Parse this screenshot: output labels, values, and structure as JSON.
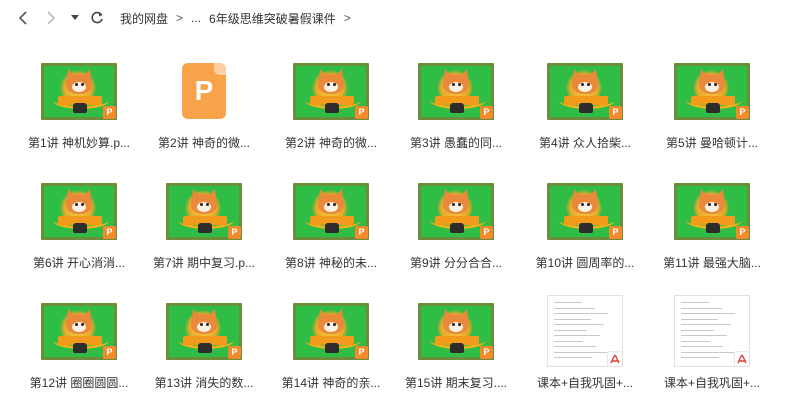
{
  "toolbar": {
    "back_icon": "chevron-left-icon",
    "forward_icon": "chevron-right-icon",
    "history_icon": "caret-down-icon",
    "refresh_icon": "refresh-icon"
  },
  "breadcrumb": {
    "root": "我的网盘",
    "separator": ">",
    "ellipsis": "...",
    "current": "6年级思维突破暑假课件"
  },
  "colors": {
    "slide_green": "#2fbd45",
    "ppt_orange": "#f38a2b",
    "pdf_red": "#e43a3a"
  },
  "files": [
    {
      "label": "第1讲 神机妙算.p...",
      "kind": "ppt-thumb"
    },
    {
      "label": "第2讲 神奇的微...",
      "kind": "ppt-icon"
    },
    {
      "label": "第2讲 神奇的微...",
      "kind": "ppt-thumb"
    },
    {
      "label": "第3讲 愚蠢的同...",
      "kind": "ppt-thumb"
    },
    {
      "label": "第4讲 众人拾柴...",
      "kind": "ppt-thumb"
    },
    {
      "label": "第5讲 曼哈顿计...",
      "kind": "ppt-thumb"
    },
    {
      "label": "第6讲 开心消消...",
      "kind": "ppt-thumb"
    },
    {
      "label": "第7讲 期中复习.p...",
      "kind": "ppt-thumb"
    },
    {
      "label": "第8讲 神秘的未...",
      "kind": "ppt-thumb"
    },
    {
      "label": "第9讲 分分合合...",
      "kind": "ppt-thumb"
    },
    {
      "label": "第10讲 圆周率的...",
      "kind": "ppt-thumb"
    },
    {
      "label": "第11讲 最强大脑...",
      "kind": "ppt-thumb"
    },
    {
      "label": "第12讲 圈圈圆圆...",
      "kind": "ppt-thumb"
    },
    {
      "label": "第13讲 消失的数...",
      "kind": "ppt-thumb"
    },
    {
      "label": "第14讲 神奇的亲...",
      "kind": "ppt-thumb"
    },
    {
      "label": "第15讲 期末复习....",
      "kind": "ppt-thumb"
    },
    {
      "label": "课本+自我巩固+...",
      "kind": "pdf-thumb"
    },
    {
      "label": "课本+自我巩固+...",
      "kind": "pdf-thumb"
    }
  ],
  "badges": {
    "ppt": "P",
    "pdf": "⅄"
  }
}
